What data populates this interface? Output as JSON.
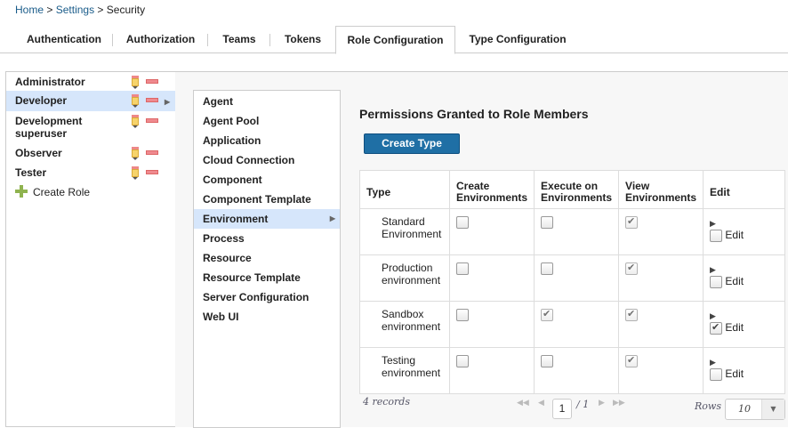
{
  "breadcrumb": {
    "home": "Home",
    "settings": "Settings",
    "current": "Security",
    "sep": ">"
  },
  "tabs": [
    "Authentication",
    "Authorization",
    "Teams",
    "Tokens",
    "Role Configuration",
    "Type Configuration"
  ],
  "roles": [
    "Administrator",
    "Developer",
    "Development superuser",
    "Observer",
    "Tester"
  ],
  "create_role": "Create Role",
  "resources": [
    "Agent",
    "Agent Pool",
    "Application",
    "Cloud Connection",
    "Component",
    "Component Template",
    "Environment",
    "Process",
    "Resource",
    "Resource Template",
    "Server Configuration",
    "Web UI"
  ],
  "panel_title": "Permissions Granted to Role Members",
  "create_type": "Create Type",
  "columns": [
    "Type",
    "Create Environments",
    "Execute on Environments",
    "View Environments",
    "Edit"
  ],
  "rows": [
    {
      "type": "Standard Environment",
      "create": false,
      "execute": false,
      "view": true,
      "edit": false
    },
    {
      "type": "Production environment",
      "create": false,
      "execute": false,
      "view": true,
      "edit": false
    },
    {
      "type": "Sandbox environment",
      "create": false,
      "execute": true,
      "view": true,
      "edit": true
    },
    {
      "type": "Testing environment",
      "create": false,
      "execute": false,
      "view": true,
      "edit": false
    }
  ],
  "edit_label": "Edit",
  "footer": {
    "records": "4 records",
    "page": "1",
    "of": "/ 1",
    "rows_label": "Rows",
    "rows_value": "10"
  }
}
